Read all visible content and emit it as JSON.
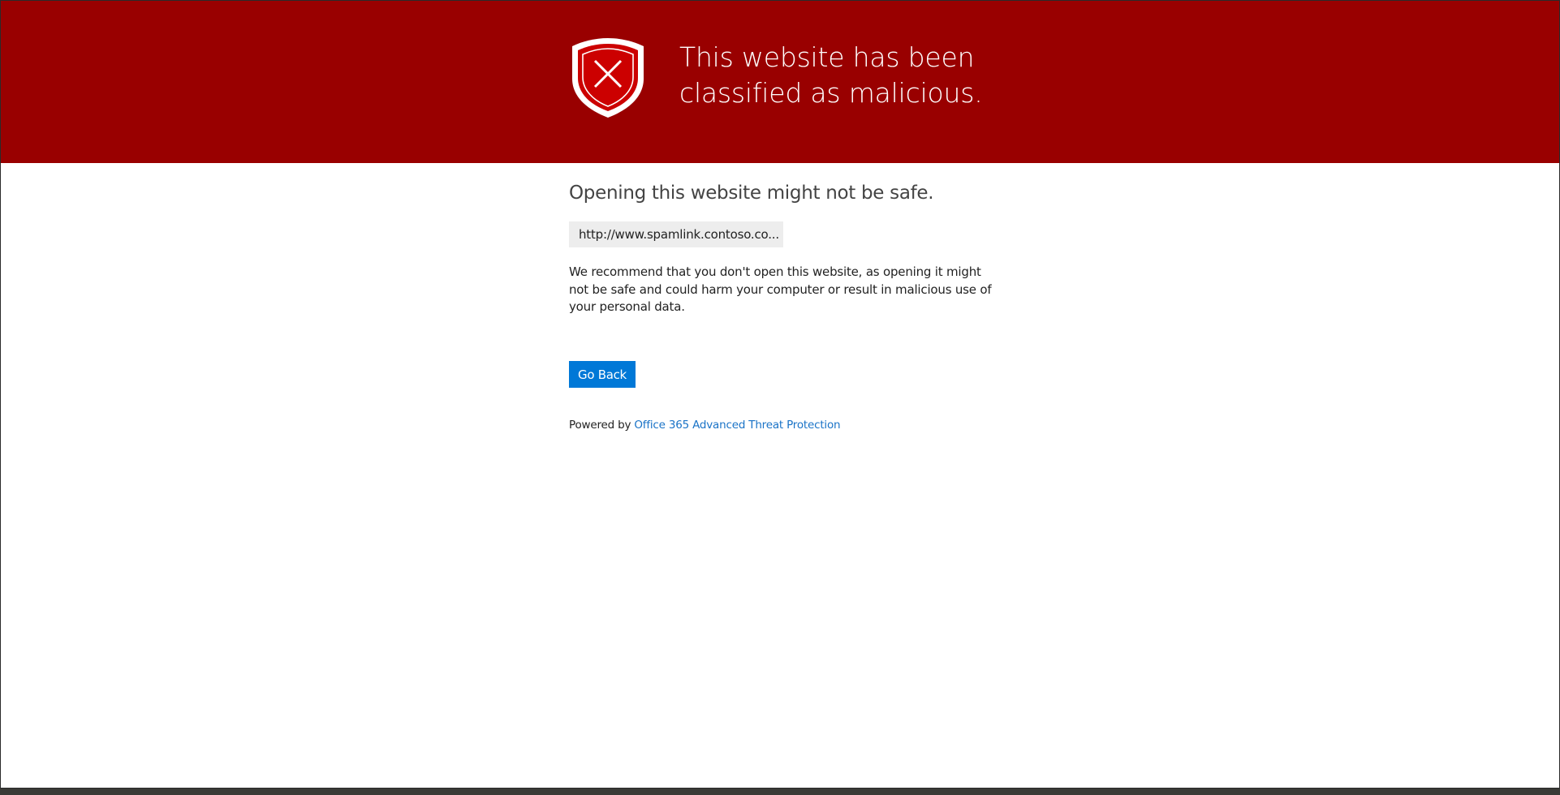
{
  "banner": {
    "icon": "shield-x-icon",
    "title_line1": "This website has been",
    "title_line2": "classified as malicious."
  },
  "content": {
    "subtitle": "Opening this website might not be safe.",
    "url": "http://www.spamlink.contoso.co...",
    "message": "We recommend that you don't open this website, as opening it might not be safe and could harm your computer or result in malicious use of your personal data.",
    "go_back_label": "Go Back",
    "powered_by_text": "Powered by",
    "powered_by_link": "Office 365 Advanced Threat Protection"
  },
  "colors": {
    "banner_background": "#990000",
    "shield_fill": "#cc0000",
    "shield_outline": "#ffffff",
    "button_background": "#0078d7",
    "link": "#1a73c7",
    "url_box_background": "#ededed"
  }
}
